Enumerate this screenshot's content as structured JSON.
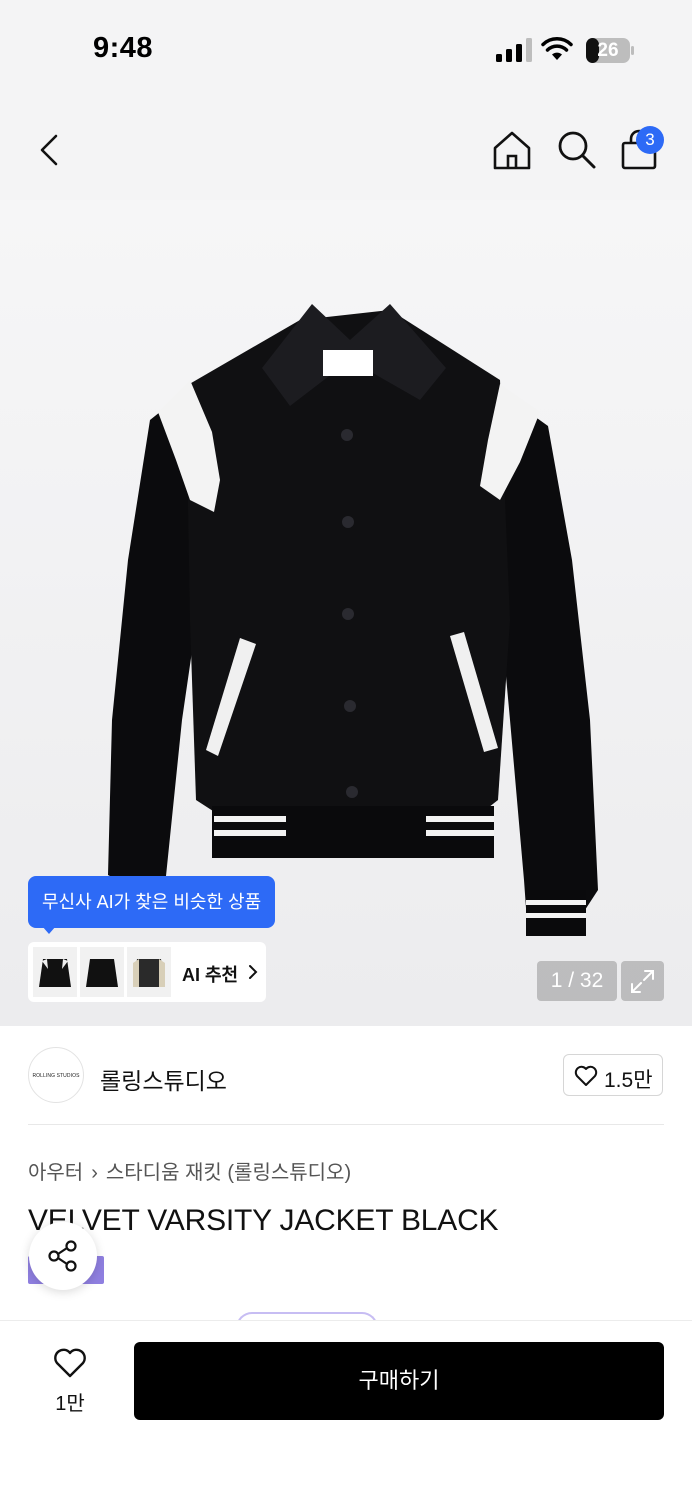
{
  "status_bar": {
    "time": "9:48",
    "battery": "26"
  },
  "nav": {
    "back_icon": "chevron-left-icon",
    "home_icon": "home-icon",
    "search_icon": "search-icon",
    "cart_icon": "shopping-bag-icon",
    "cart_badge": "3",
    "badge_color": "#2d6af6"
  },
  "gallery": {
    "ai_tooltip": "무신사 AI가 찾은 비슷한 상품",
    "ai_recommend_label": "AI 추천",
    "page_counter": "1 / 32",
    "expand_icon": "expand-icon"
  },
  "brand": {
    "logo_text": "ROLLING STUDIOS",
    "name": "롤링스튜디오",
    "like_count": "1.5만"
  },
  "product": {
    "breadcrumb": [
      "아우터",
      "스타디움 재킷 (롤링스튜디오)"
    ],
    "title": "VELVET VARSITY JACKET BLACK"
  },
  "bottom": {
    "wish_count": "1만",
    "buy_label": "구매하기"
  }
}
